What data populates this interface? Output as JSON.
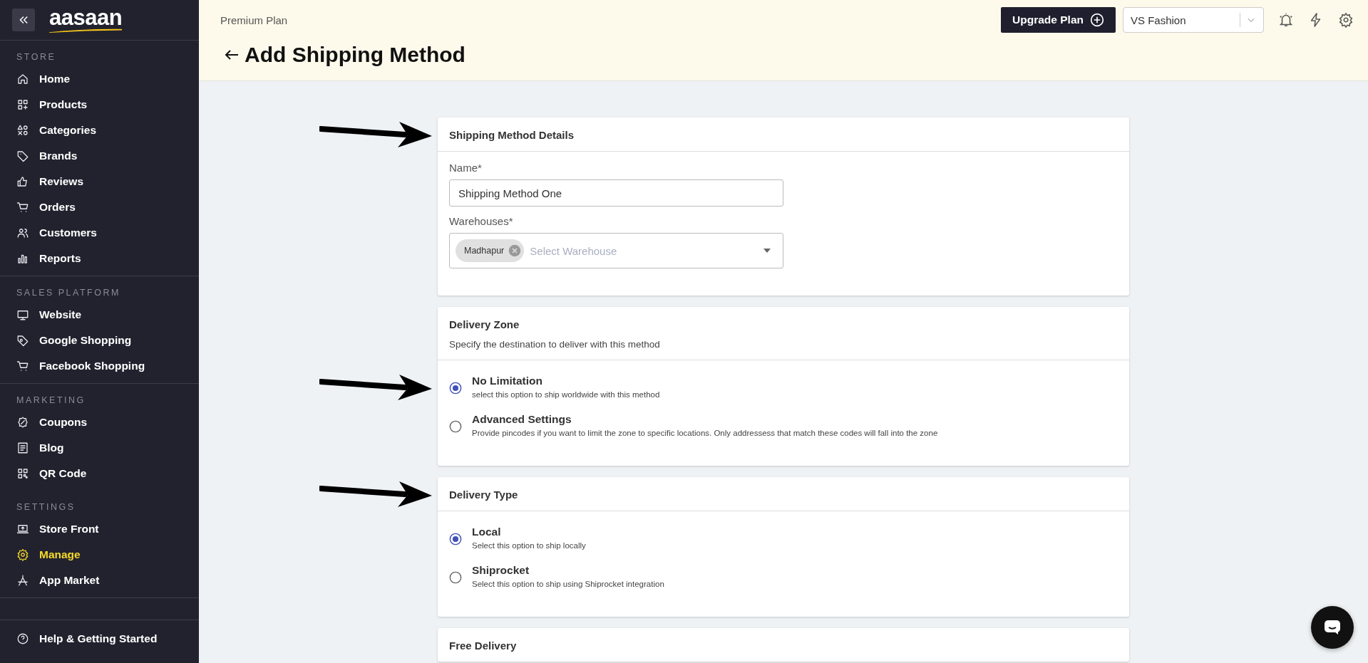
{
  "sidebar": {
    "logo": "aasaan",
    "sections": [
      {
        "label": "STORE",
        "items": [
          {
            "label": "Home",
            "selected": false
          },
          {
            "label": "Products",
            "selected": false
          },
          {
            "label": "Categories",
            "selected": false
          },
          {
            "label": "Brands",
            "selected": false
          },
          {
            "label": "Reviews",
            "selected": false
          },
          {
            "label": "Orders",
            "selected": false
          },
          {
            "label": "Customers",
            "selected": false
          },
          {
            "label": "Reports",
            "selected": false
          }
        ]
      },
      {
        "label": "SALES PLATFORM",
        "items": [
          {
            "label": "Website",
            "selected": false
          },
          {
            "label": "Google Shopping",
            "selected": false
          },
          {
            "label": "Facebook Shopping",
            "selected": false
          }
        ]
      },
      {
        "label": "MARKETING",
        "items": [
          {
            "label": "Coupons",
            "selected": false
          },
          {
            "label": "Blog",
            "selected": false
          },
          {
            "label": "QR Code",
            "selected": false
          }
        ]
      },
      {
        "label": "SETTINGS",
        "items": [
          {
            "label": "Store Front",
            "selected": false
          },
          {
            "label": "Manage",
            "selected": true
          },
          {
            "label": "App Market",
            "selected": false
          }
        ]
      }
    ],
    "help": "Help & Getting Started"
  },
  "header": {
    "plan": "Premium Plan",
    "upgrade_button": "Upgrade Plan",
    "store_select": "VS Fashion",
    "title": "Add Shipping Method"
  },
  "cards": [
    {
      "title": "Shipping Method Details",
      "arrow": true,
      "fields": [
        {
          "kind": "text",
          "label": "Name*",
          "value": "Shipping Method One"
        },
        {
          "kind": "multiselect",
          "label": "Warehouses*",
          "chips": [
            "Madhapur"
          ],
          "placeholder": "Select Warehouse"
        }
      ]
    },
    {
      "title": "Delivery Zone",
      "subtitle": "Specify the destination to deliver with this method",
      "arrow": false,
      "options": [
        {
          "label": "No Limitation",
          "description": "select this option to ship worldwide with this method",
          "selected": true,
          "arrow": true
        },
        {
          "label": "Advanced Settings",
          "description": "Provide pincodes if you want to limit the zone to specific locations. Only addressess that match these codes will fall into the zone",
          "selected": false,
          "arrow": false
        }
      ]
    },
    {
      "title": "Delivery Type",
      "arrow": true,
      "options": [
        {
          "label": "Local",
          "description": "Select this option to ship locally",
          "selected": true,
          "arrow": false
        },
        {
          "label": "Shiprocket",
          "description": "Select this option to ship using Shiprocket integration",
          "selected": false,
          "arrow": false
        }
      ]
    },
    {
      "title": "Free Delivery",
      "arrow": false
    }
  ]
}
